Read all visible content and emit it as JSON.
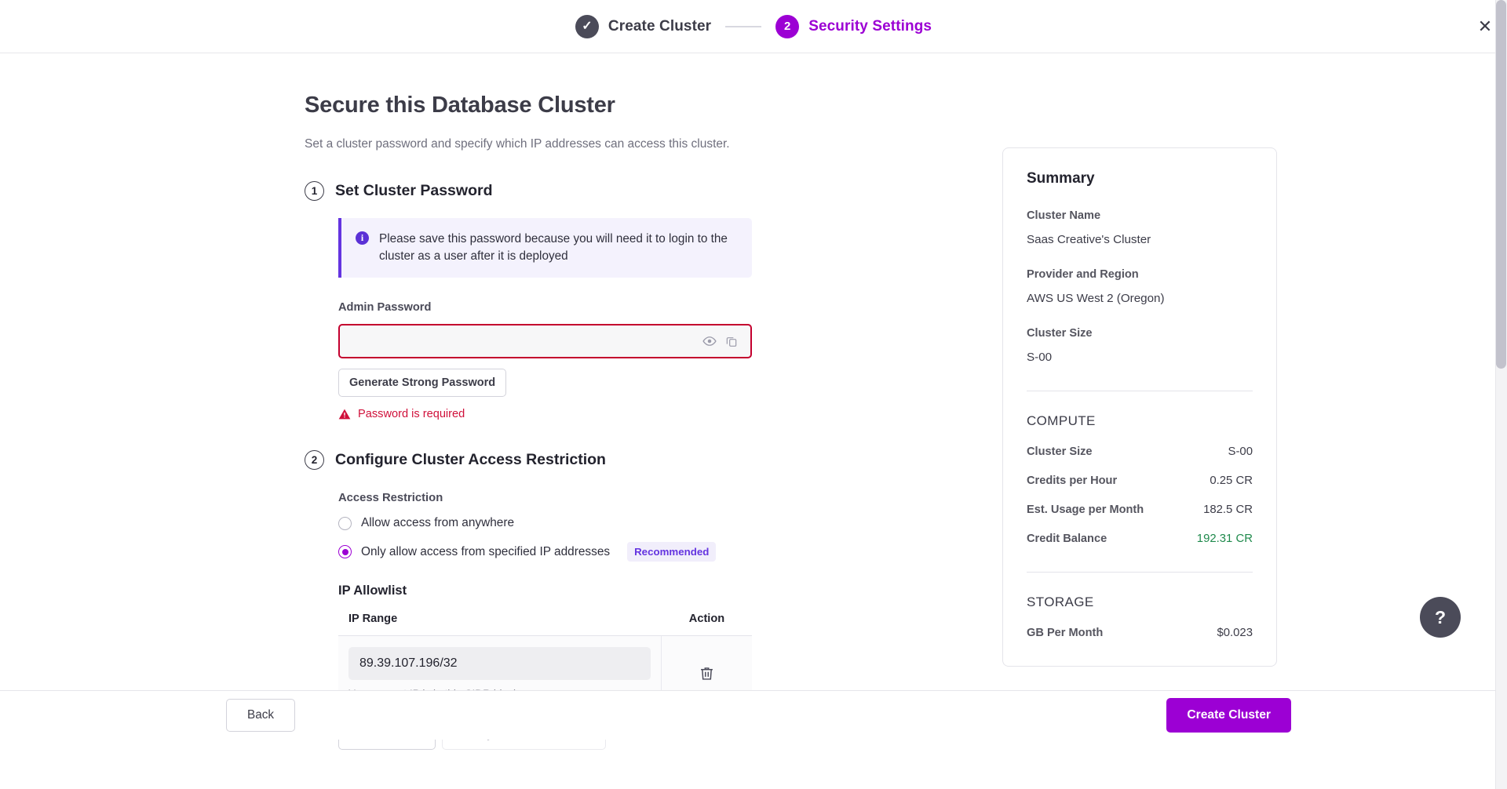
{
  "stepper": {
    "step1": {
      "label": "Create Cluster",
      "state": "done",
      "icon": "check-icon"
    },
    "step2": {
      "label": "Security Settings",
      "number": "2",
      "state": "active"
    }
  },
  "window": {
    "close_icon": "close-icon"
  },
  "main": {
    "title": "Secure this Database Cluster",
    "subtitle": "Set a cluster password and specify which IP addresses can access this cluster.",
    "section1": {
      "number": "1",
      "title": "Set Cluster Password",
      "alert": {
        "icon": "info-icon",
        "text": "Please save this password because you will need it to login to the cluster as a user after it is deployed"
      },
      "password_label": "Admin Password",
      "password_value": "",
      "password_placeholder": "",
      "reveal_icon": "eye-icon",
      "copy_icon": "copy-icon",
      "generate_button": "Generate Strong Password",
      "error_icon": "warning-icon",
      "error_text": "Password is required"
    },
    "section2": {
      "number": "2",
      "title": "Configure Cluster Access Restriction",
      "access_label": "Access Restriction",
      "options": [
        {
          "label": "Allow access from anywhere",
          "selected": false,
          "badge": ""
        },
        {
          "label": "Only allow access from specified IP addresses",
          "selected": true,
          "badge": "Recommended"
        }
      ],
      "allowlist_title": "IP Allowlist",
      "table": {
        "columns": [
          "IP Range",
          "Action"
        ],
        "rows": [
          {
            "ip_range": "89.39.107.196/32",
            "hint": "Your current IP is in this CIDR block.",
            "action_icon": "trash-icon"
          }
        ]
      },
      "add_new_ip_button": "+ Add New IP",
      "add_current_ip_button": "Add My Current IP Address"
    }
  },
  "summary": {
    "title": "Summary",
    "cluster_name_label": "Cluster Name",
    "cluster_name_value": "Saas Creative's Cluster",
    "provider_label": "Provider and Region",
    "provider_value": "AWS US West 2 (Oregon)",
    "cluster_size_label": "Cluster Size",
    "cluster_size_value": "S-00",
    "compute_heading": "COMPUTE",
    "compute_rows": [
      {
        "key": "Cluster Size",
        "value": "S-00",
        "color": ""
      },
      {
        "key": "Credits per Hour",
        "value": "0.25 CR",
        "color": ""
      },
      {
        "key": "Est. Usage per Month",
        "value": "182.5 CR",
        "color": ""
      },
      {
        "key": "Credit Balance",
        "value": "192.31 CR",
        "color": "#1f8a4c"
      }
    ],
    "storage_heading": "STORAGE",
    "storage_rows": [
      {
        "key": "GB Per Month",
        "value": "$0.023",
        "color": ""
      }
    ]
  },
  "footer": {
    "back_button": "Back",
    "create_button": "Create Cluster"
  },
  "help": {
    "label": "?",
    "icon": "question-mark-icon"
  },
  "colors": {
    "accent": "#9c00d4",
    "alert_border": "#6434e0",
    "error": "#d0103a",
    "positive": "#1f8a4c"
  }
}
